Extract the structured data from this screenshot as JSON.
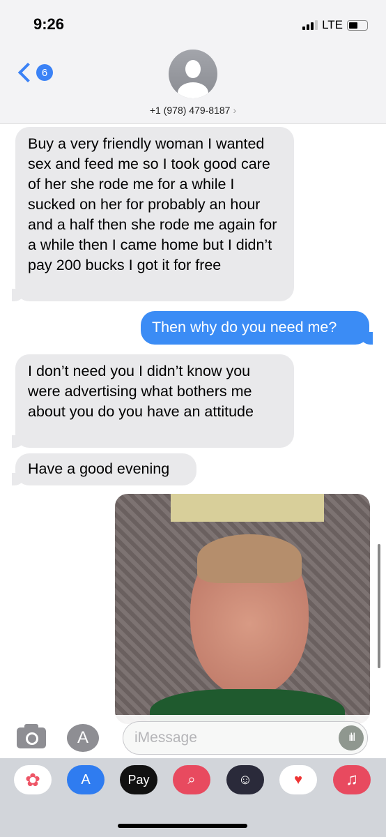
{
  "status_bar": {
    "time": "9:26",
    "network": "LTE"
  },
  "header": {
    "back_badge": "6",
    "contact": "+1 (978) 479-8187",
    "chevron": "›"
  },
  "messages": [
    {
      "from": "them",
      "text": "Buy a very friendly woman I wanted sex and feed me so I took good care of her she rode me for a while I sucked on her for probably an hour and a half then she rode me again for a while then I came home but I didn’t pay 200 bucks I got it for free"
    },
    {
      "from": "me",
      "text": "Then why do you need me?"
    },
    {
      "from": "them",
      "text": "I don’t need you I didn’t know you were advertising what bothers me about you do you have an attitude"
    },
    {
      "from": "them",
      "text": "Have a good evening"
    },
    {
      "from": "me",
      "type": "photo"
    }
  ],
  "input": {
    "placeholder": "iMessage"
  },
  "drawer": {
    "apple_pay": "Pay"
  },
  "colors": {
    "blue": "#3b8cf5",
    "gray_bubble": "#e9e9eb"
  }
}
